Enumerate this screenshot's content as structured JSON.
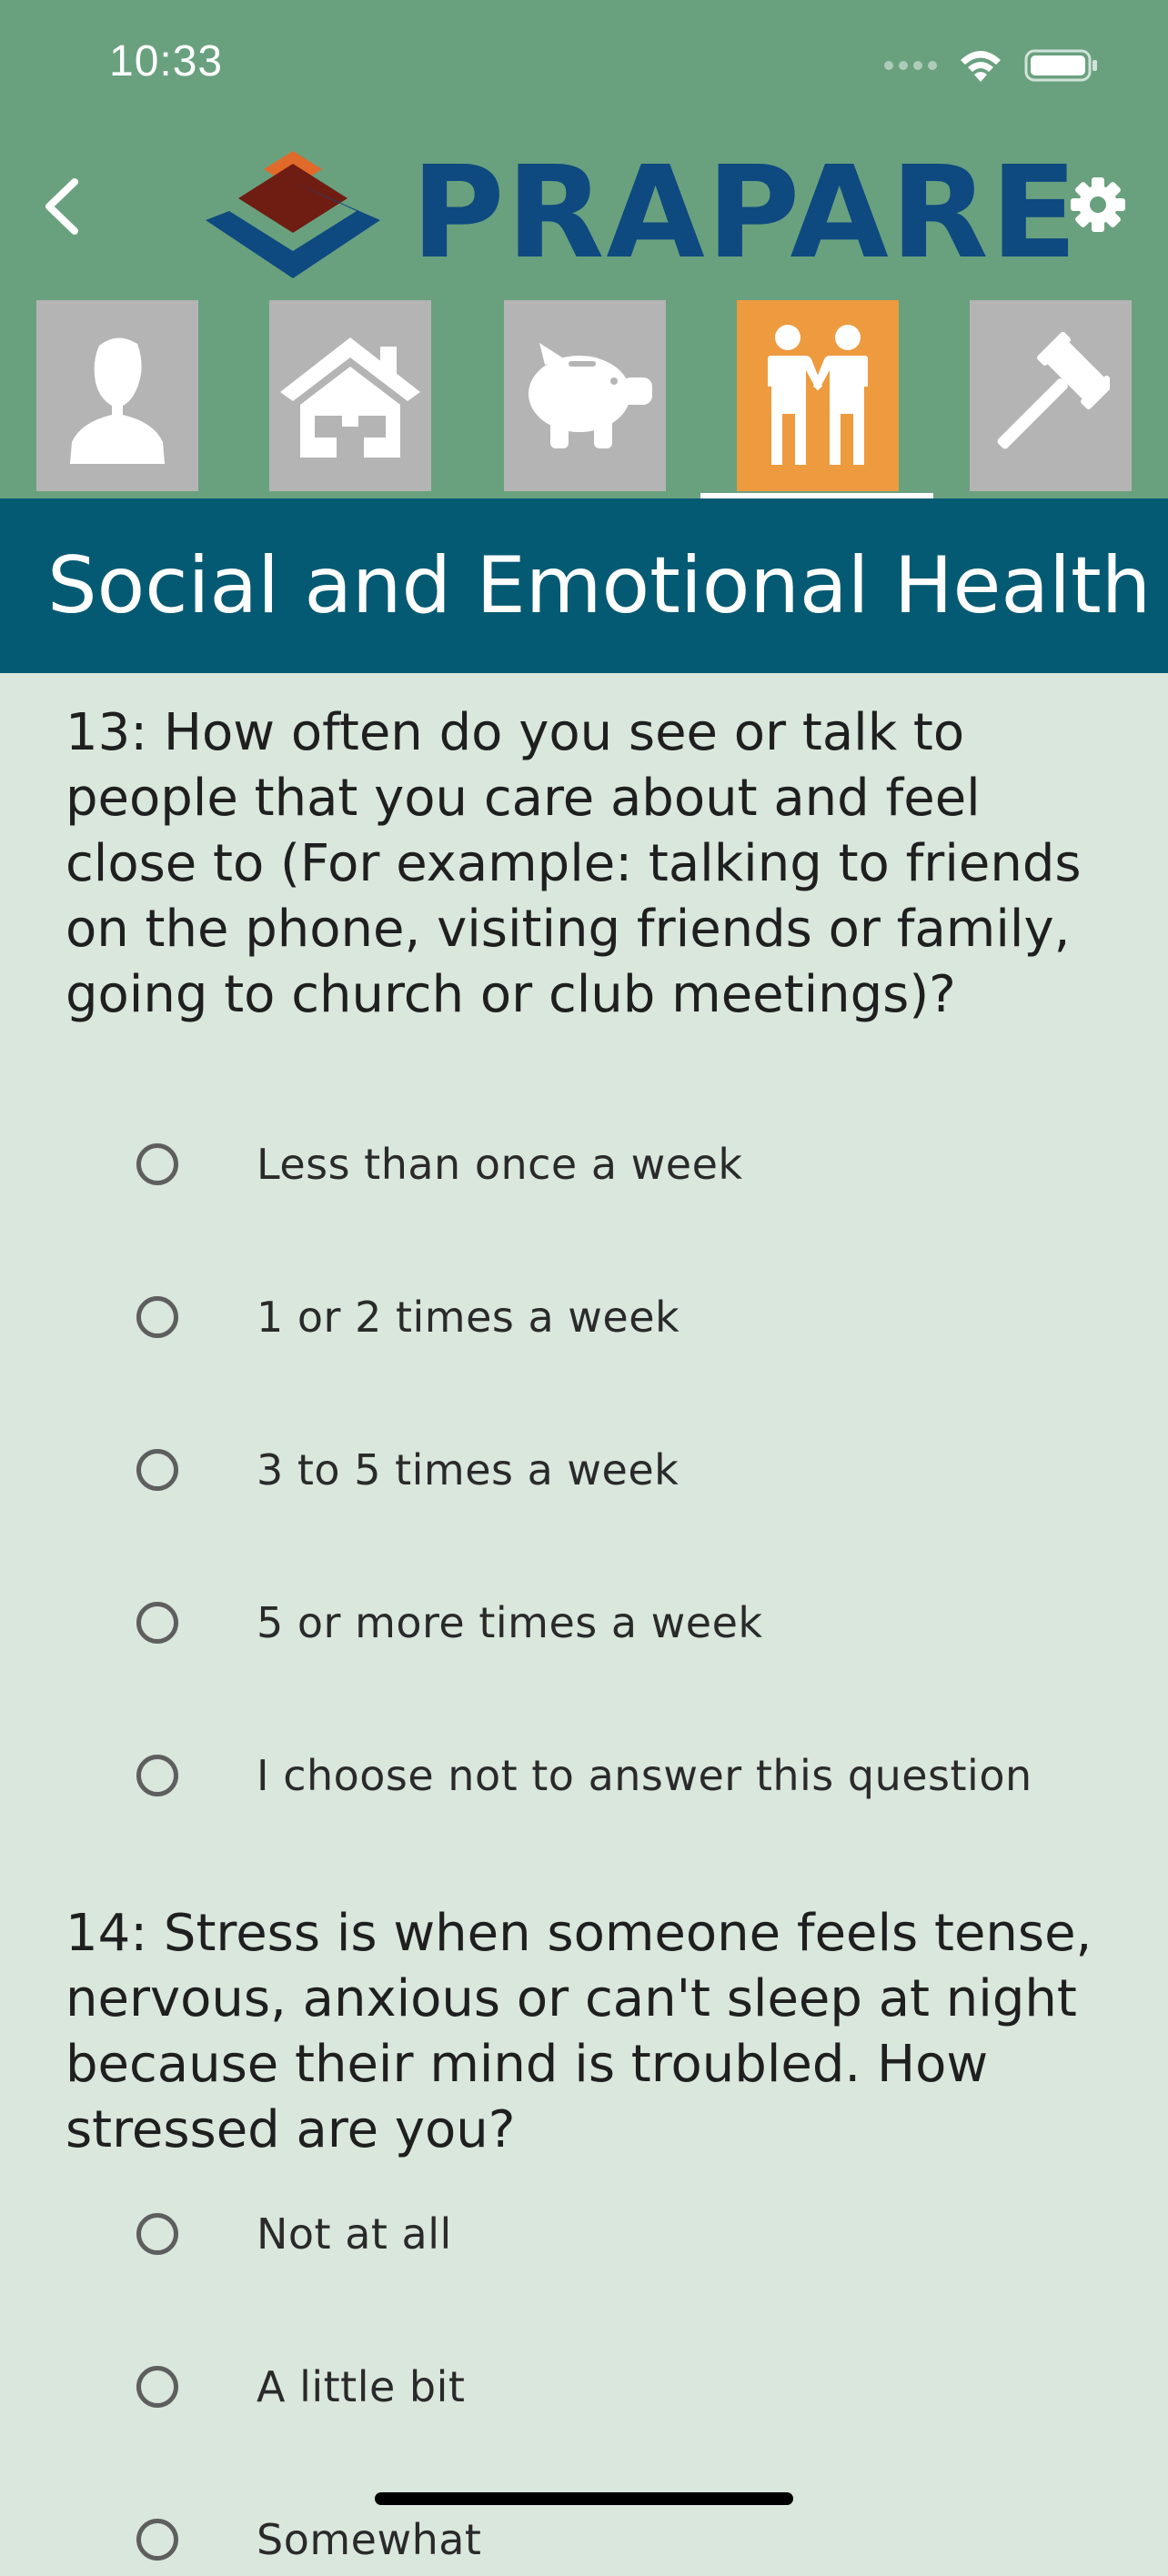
{
  "status_bar": {
    "time": "10:33"
  },
  "header": {
    "logo_text": "PRAPARE",
    "back_icon": "chevron-left-icon",
    "settings_icon": "gear-icon"
  },
  "tabs": [
    {
      "icon": "person-icon",
      "active": false
    },
    {
      "icon": "house-icon",
      "active": false
    },
    {
      "icon": "piggy-bank-icon",
      "active": false
    },
    {
      "icon": "people-holding-hands-icon",
      "active": true
    },
    {
      "icon": "gavel-icon",
      "active": false
    }
  ],
  "section": {
    "title": "Social and Emotional Health"
  },
  "questions": [
    {
      "text": "13: How often do you see or talk to people that you care about and feel close to (For example: talking to friends on the phone, visiting friends or family, going to church or club meetings)?",
      "options": [
        "Less than once a week",
        "1 or 2 times a week",
        "3 to 5 times a week",
        "5 or more times a week",
        "I choose not to answer this question"
      ]
    },
    {
      "text": "14: Stress is when someone feels tense, nervous, anxious or can't sleep at night because their mind is troubled. How stressed are you?",
      "options": [
        "Not at all",
        "A little bit",
        "Somewhat"
      ]
    }
  ],
  "colors": {
    "header_bg": "#69a17f",
    "section_bg": "#045a72",
    "page_bg": "#d9e7dd",
    "tab_inactive": "#b4b4b4",
    "tab_active": "#ee9a3e",
    "logo_blue": "#0e4a80"
  }
}
